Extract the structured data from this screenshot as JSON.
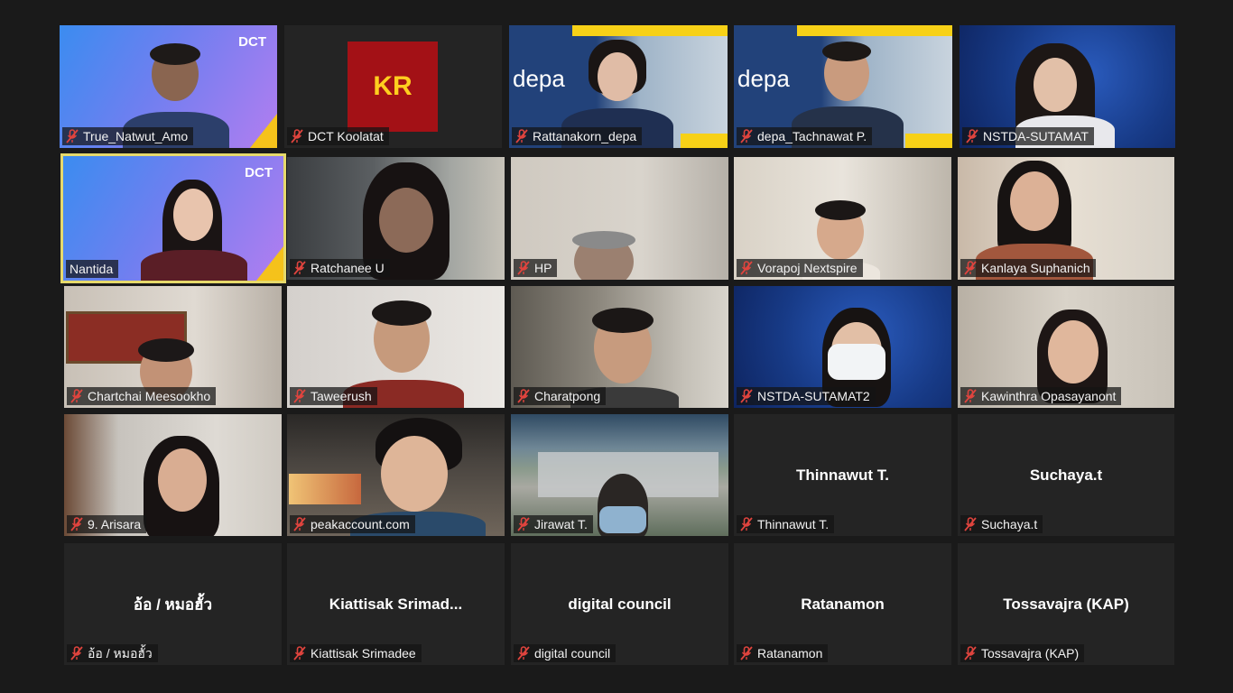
{
  "meeting": {
    "participants": [
      {
        "name": "True_Natwut_Amo",
        "muted": true
      },
      {
        "name": "DCT Koolatat",
        "muted": true,
        "logo": "KR"
      },
      {
        "name": "Rattanakorn_depa",
        "muted": true,
        "brand": "depa"
      },
      {
        "name": "depa_Tachnawat P.",
        "muted": true,
        "brand": "depa"
      },
      {
        "name": "NSTDA-SUTAMAT",
        "muted": true
      },
      {
        "name": "Nantida",
        "muted": false,
        "active_speaker": true,
        "brand": "DCT"
      },
      {
        "name": "Ratchanee U",
        "muted": true
      },
      {
        "name": "HP",
        "muted": true
      },
      {
        "name": "Vorapoj Nextspire",
        "muted": true
      },
      {
        "name": "Kanlaya Suphanich",
        "muted": true
      },
      {
        "name": "Chartchai Meesookho",
        "muted": true
      },
      {
        "name": "Taweerush",
        "muted": true
      },
      {
        "name": "Charatpong",
        "muted": true
      },
      {
        "name": "NSTDA-SUTAMAT2",
        "muted": true
      },
      {
        "name": "Kawinthra Opasayanont",
        "muted": true
      },
      {
        "name": "9. Arisara",
        "muted": true
      },
      {
        "name": "peakaccount.com",
        "muted": true
      },
      {
        "name": "Jirawat T.",
        "muted": true
      },
      {
        "name": "Thinnawut T.",
        "muted": true,
        "display_name": "Thinnawut T."
      },
      {
        "name": "Suchaya.t",
        "muted": true,
        "display_name": "Suchaya.t"
      },
      {
        "name": "อ้อ / หมอฮั้ว",
        "muted": true,
        "display_name": "อ้อ / หมอฮั้ว"
      },
      {
        "name": "Kiattisak Srimadee",
        "muted": true,
        "display_name": "Kiattisak  Srimad..."
      },
      {
        "name": "digital council",
        "muted": true,
        "display_name": "digital council"
      },
      {
        "name": "Ratanamon",
        "muted": true,
        "display_name": "Ratanamon"
      },
      {
        "name": "Tossavajra (KAP)",
        "muted": true,
        "display_name": "Tossavajra (KAP)"
      }
    ],
    "colors": {
      "background": "#1a1a1a",
      "tile": "#242424",
      "active_border": "#e6d96b",
      "muted_icon": "#e0443e"
    }
  }
}
